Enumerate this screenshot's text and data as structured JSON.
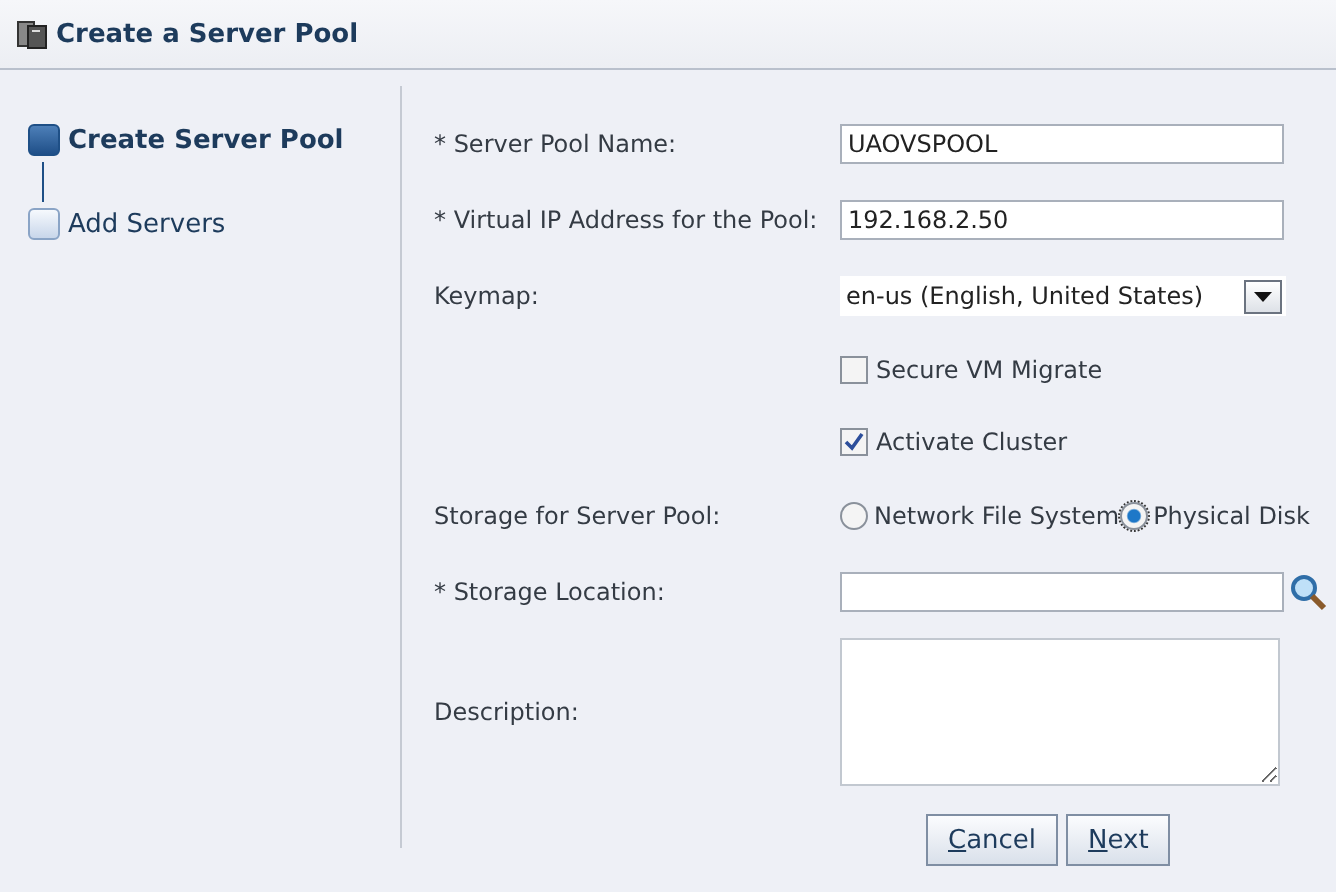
{
  "header": {
    "title": "Create a Server Pool"
  },
  "steps": [
    {
      "label": "Create Server Pool",
      "selected": true
    },
    {
      "label": "Add Servers",
      "selected": false
    }
  ],
  "fields": [
    {
      "kind": "text",
      "label": "* Server Pool Name:",
      "value": "UAOVSPOOL"
    },
    {
      "kind": "text",
      "label": "* Virtual IP Address for the Pool:",
      "value": "192.168.2.50"
    },
    {
      "kind": "select",
      "label": "Keymap:",
      "value": "en-us (English, United States)"
    },
    {
      "kind": "checkbox",
      "text": "Secure VM Migrate",
      "checked": false
    },
    {
      "kind": "checkbox",
      "text": "Activate Cluster",
      "checked": true
    },
    {
      "kind": "radio",
      "label": "Storage for Server Pool:",
      "options": [
        {
          "text": "Network File System",
          "selected": false
        },
        {
          "text": "Physical Disk",
          "selected": true
        }
      ]
    },
    {
      "kind": "search",
      "label": "* Storage Location:"
    },
    {
      "kind": "textarea",
      "label": "Description:"
    }
  ],
  "buttons": [
    {
      "mnemonic": "C",
      "rest": "ancel"
    },
    {
      "mnemonic": "N",
      "rest": "ext"
    }
  ]
}
